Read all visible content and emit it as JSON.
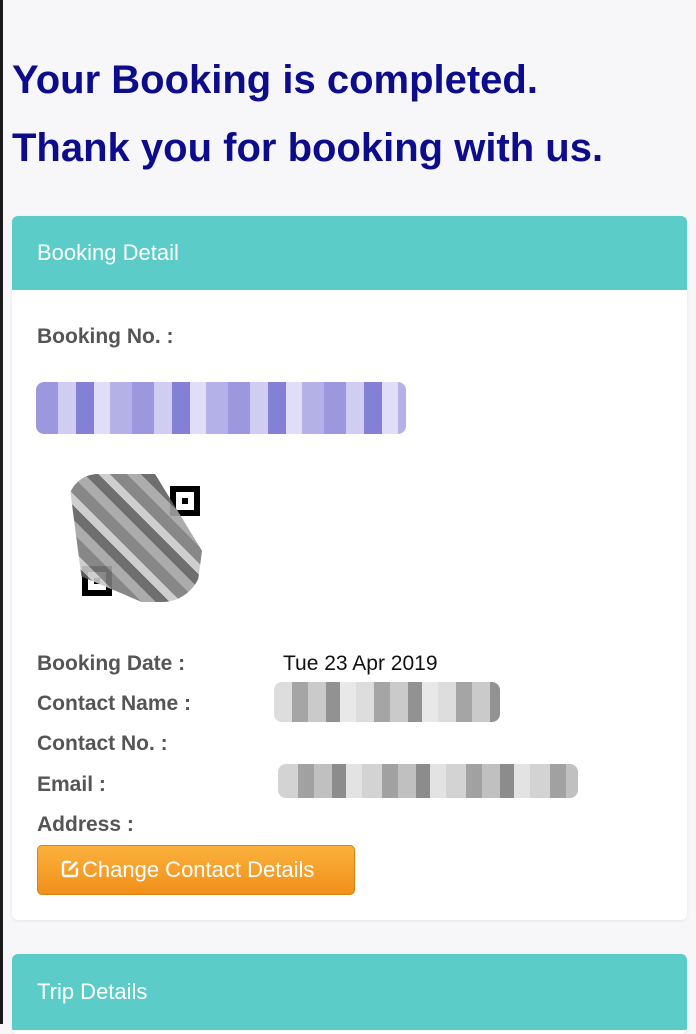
{
  "headline": {
    "line1": "Your Booking is completed.",
    "line2": "Thank you for booking with us."
  },
  "booking_panel": {
    "title": "Booking Detail",
    "booking_no_label": "Booking No. :",
    "booking_date_label": "Booking Date :",
    "booking_date_value": "Tue 23 Apr 2019",
    "contact_name_label": "Contact Name :",
    "contact_no_label": "Contact No. :",
    "email_label": "Email :",
    "address_label": "Address :",
    "change_button_label": "Change Contact Details",
    "change_button_icon": "edit-icon"
  },
  "trip_panel": {
    "title": "Trip Details"
  },
  "colors": {
    "headline": "#0d0d8c",
    "panel_header": "#5bccc7",
    "button": "#f59e22"
  }
}
